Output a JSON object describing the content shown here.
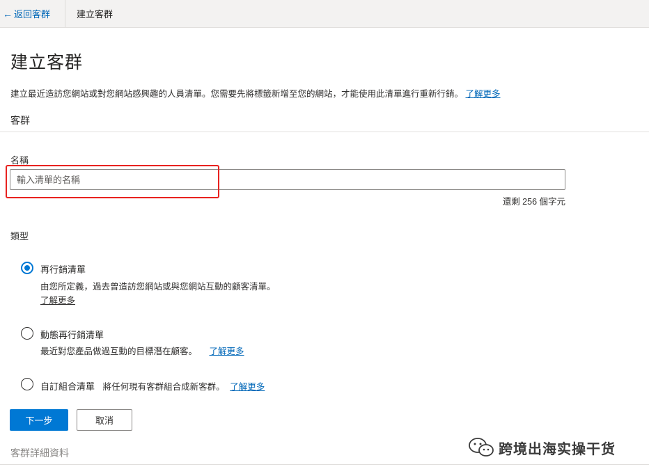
{
  "header": {
    "back_label": "返回客群",
    "breadcrumb": "建立客群"
  },
  "page": {
    "title": "建立客群",
    "description": "建立最近造訪您網站或對您網站感興趣的人員清單。您需要先將標籤新增至您的網站，才能使用此清單進行重新行銷。",
    "learn_more": "了解更多",
    "section_label": "客群"
  },
  "name_field": {
    "label": "名稱",
    "placeholder": "輸入清單的名稱",
    "value": "",
    "counter": "還剩 256 個字元"
  },
  "type_field": {
    "label": "類型",
    "options": [
      {
        "title": "再行銷清單",
        "description": "由您所定義，過去曾造訪您網站或與您網站互動的顧客清單。",
        "learn_more": "了解更多",
        "selected": true
      },
      {
        "title": "動態再行銷清單",
        "description": "最近對您產品做過互動的目標潛在顧客。",
        "learn_more": "了解更多",
        "selected": false
      },
      {
        "title": "自訂組合清單",
        "description": "將任何現有客群組合成新客群。",
        "learn_more": "了解更多",
        "selected": false
      }
    ]
  },
  "actions": {
    "next_label": "下一步",
    "cancel_label": "取消"
  },
  "details_section": {
    "label": "客群詳細資料"
  },
  "watermark": {
    "text": "跨境出海实操干货",
    "icon": "wechat-icon"
  },
  "colors": {
    "accent": "#0078d4",
    "link": "#0067b8",
    "highlight_box": "#e8221f"
  }
}
